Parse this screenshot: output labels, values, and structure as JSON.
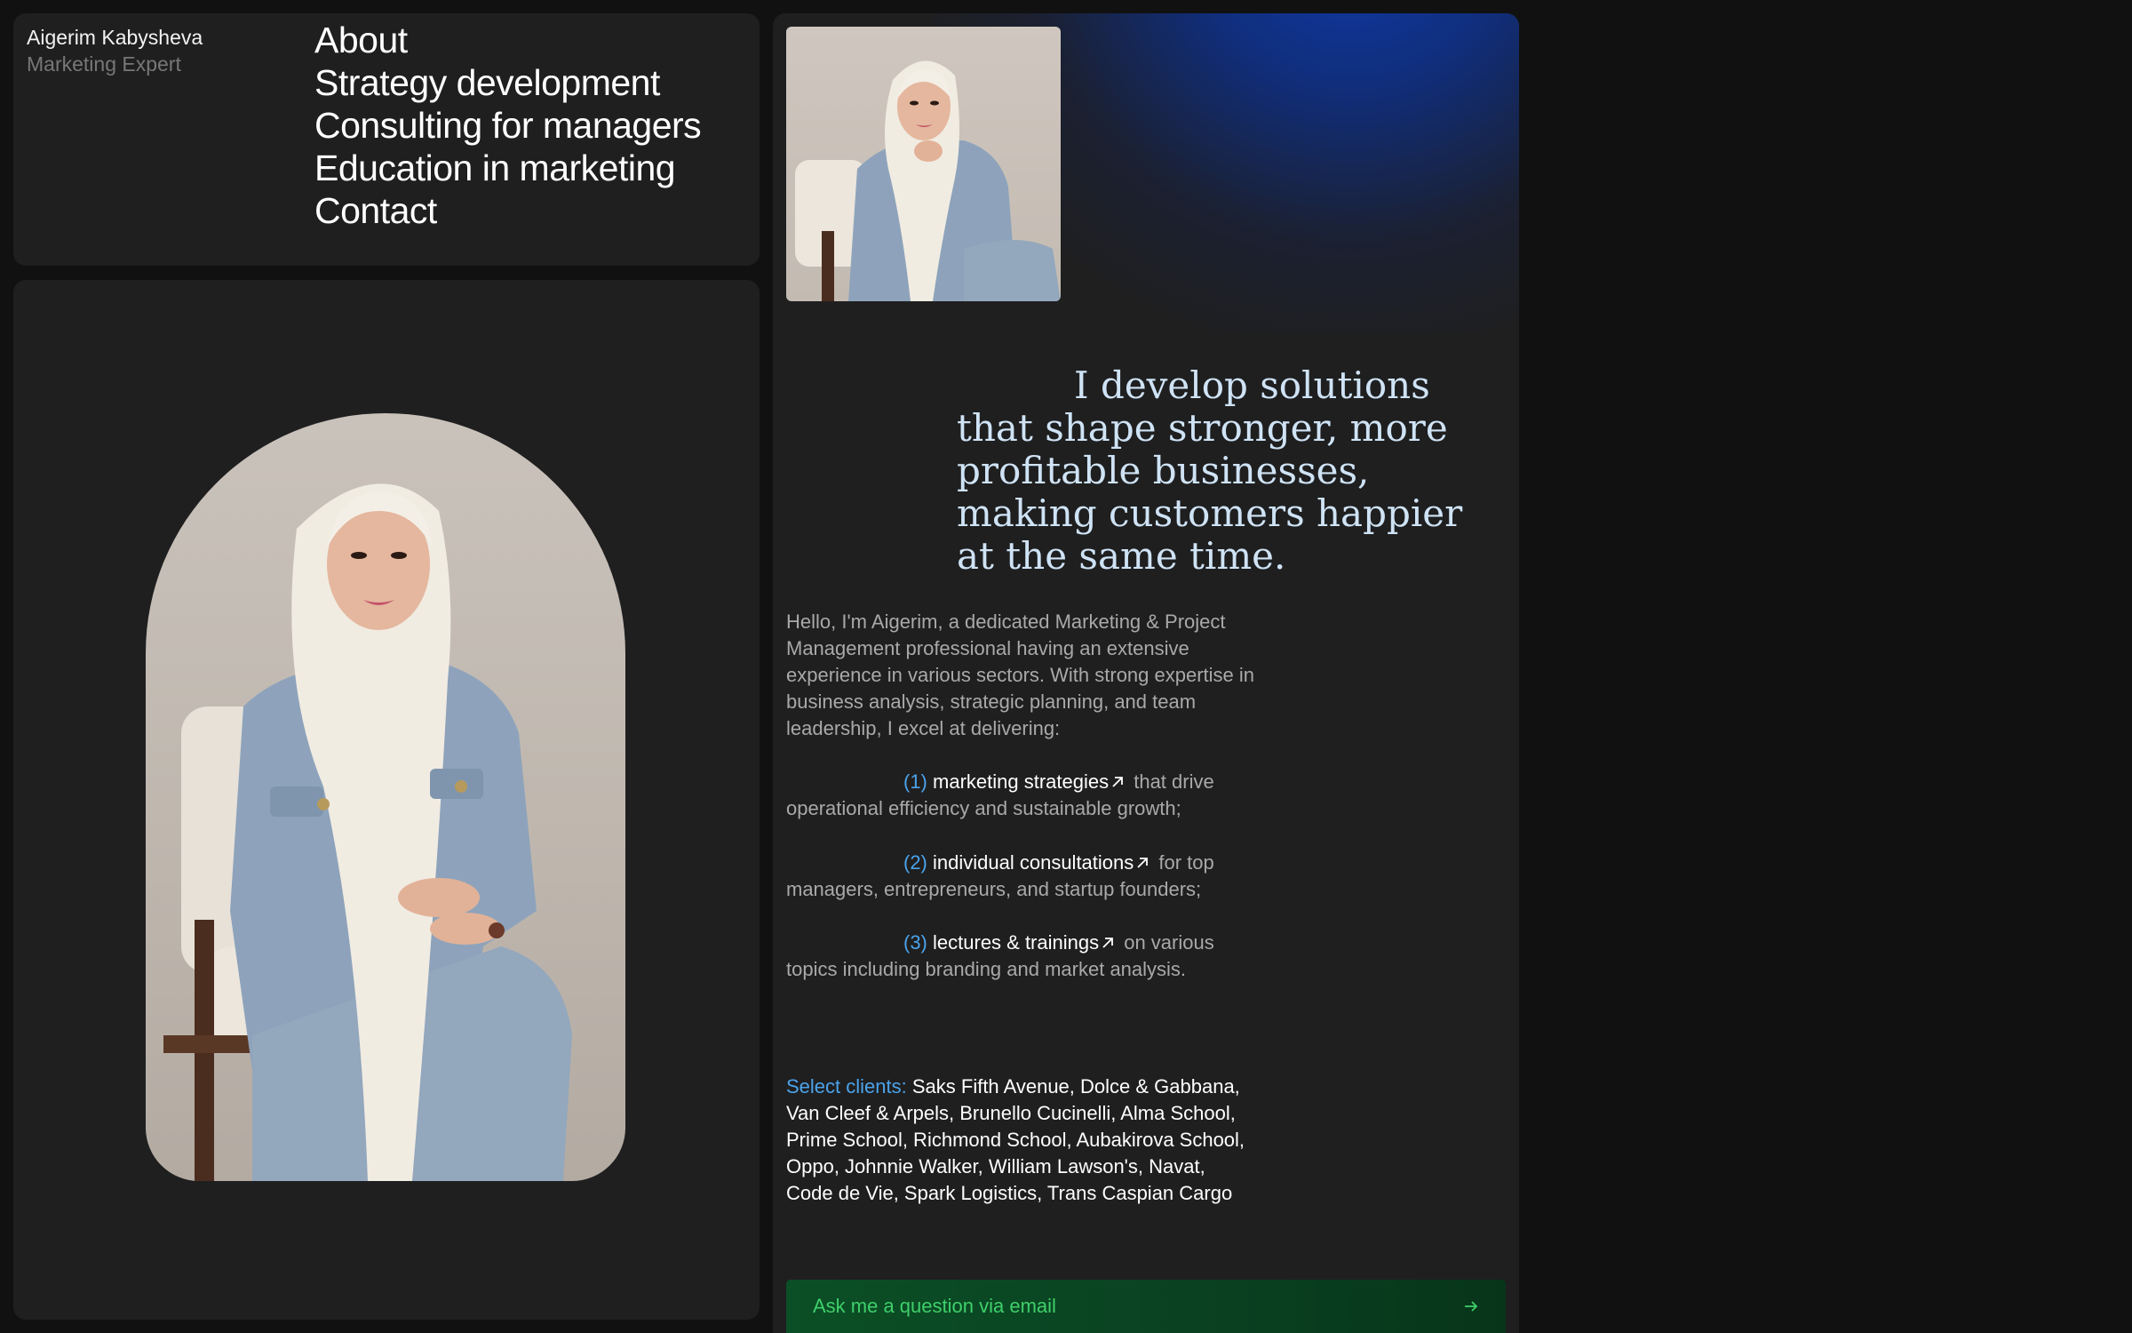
{
  "header": {
    "name": "Aigerim Kabysheva",
    "role": "Marketing Expert"
  },
  "nav": {
    "items": [
      {
        "label": "About"
      },
      {
        "label": "Strategy development"
      },
      {
        "label": "Consulting for managers"
      },
      {
        "label": "Education in marketing"
      },
      {
        "label": "Contact"
      }
    ]
  },
  "hero": {
    "headline": "I develop solutions that shape stronger, more profitable businesses, making customers happier at the same time."
  },
  "intro": {
    "text": "Hello, I'm Aigerim, a dedicated Marketing & Project Management professional having an extensive experience in various sectors. With strong expertise in business analysis, strategic planning, and team leadership, I excel at delivering:"
  },
  "services": [
    {
      "number": "(1)",
      "link": "marketing strategies",
      "rest": " that drive operational efficiency and sustainable growth;"
    },
    {
      "number": "(2)",
      "link": "individual consultations",
      "rest": " for top managers, entrepreneurs, and startup founders;"
    },
    {
      "number": "(3)",
      "link": "lectures & trainings",
      "rest": " on various topics including branding and market analysis."
    }
  ],
  "clients": {
    "label": "Select clients:",
    "list": "Saks Fifth Avenue, Dolce & Gabbana, Van Cleef & Arpels, Brunello Cucinelli, Alma School, Prime School, Richmond School, Aubakirova School, Oppo, Johnnie Walker, William Lawson's, Navat, Code de Vie, Spark Logistics, Trans Caspian Cargo"
  },
  "cta": {
    "label": "Ask me a question via email",
    "icon": "arrow-right-icon"
  },
  "colors": {
    "background": "#111111",
    "card": "#1f1f20",
    "accent_blue": "#4ba3ea",
    "headline": "#cfe3f5",
    "cta_text": "#3fcf6a",
    "cta_bg": "#0b4f26"
  }
}
